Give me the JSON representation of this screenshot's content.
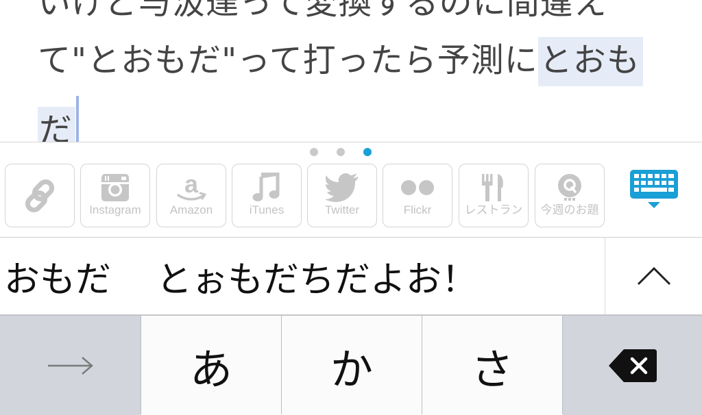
{
  "editor": {
    "line1": "いけど与汲達って変換するのに間違え",
    "line2_plain": "て\"とおもだ\"って打ったら予測に",
    "line2_marked": "とおも",
    "line3_marked": "だ"
  },
  "toolbar": {
    "page_dots": 3,
    "active_page": 3,
    "items": [
      {
        "label": "",
        "icon": "link-icon"
      },
      {
        "label": "Instagram",
        "icon": "instagram-icon"
      },
      {
        "label": "Amazon",
        "icon": "amazon-icon"
      },
      {
        "label": "iTunes",
        "icon": "music-note-icon"
      },
      {
        "label": "Twitter",
        "icon": "twitter-bird-icon"
      },
      {
        "label": "Flickr",
        "icon": "flickr-icon"
      },
      {
        "label": "レストラン",
        "icon": "fork-knife-icon"
      },
      {
        "label": "今週のお題",
        "icon": "q-badge-icon"
      }
    ],
    "keyboard_toggle_icon": "keyboard-icon"
  },
  "candidates": {
    "items": [
      "おもだ",
      "とぉもだちだよお！"
    ],
    "expand_icon": "chevron-up-icon"
  },
  "keys": {
    "next": "→",
    "a": "あ",
    "ka": "か",
    "sa": "さ",
    "delete_icon": "backspace-icon"
  },
  "colors": {
    "accent": "#1a9fd6",
    "marked_text_bg": "#e6ecf7",
    "caret": "#9db3e6",
    "icon_gray": "#c6c6c6",
    "function_key": "#d2d5db"
  }
}
